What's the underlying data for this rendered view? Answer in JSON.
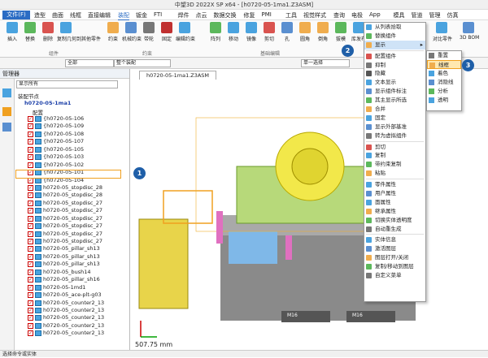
{
  "window": {
    "title": "中望3D 2022X SP x64 - [h0720-05-1ma1.Z3ASM]"
  },
  "menu": {
    "file": "文件(F)",
    "items": [
      "造型",
      "曲面",
      "线框",
      "直接编辑",
      "装配",
      "钣金",
      "FTI",
      "焊件",
      "点云",
      "数据交换",
      "修复",
      "PMI",
      "工具",
      "视觉样式",
      "查询",
      "电极",
      "App",
      "模具",
      "管道",
      "管理",
      "仿真"
    ]
  },
  "ribbon": {
    "buttons": [
      "插入",
      "替换",
      "删除",
      "复制几何到其他零件",
      "约束",
      "机械约束",
      "带轮",
      "固定",
      "编辑约束",
      "阵列",
      "移动",
      "镜像",
      "剪切",
      "孔",
      "圆角",
      "倒角",
      "拔模",
      "库发布",
      "检查",
      "对比零件",
      "3D BOM"
    ],
    "groups": [
      "组件",
      "约束",
      "基础编辑",
      "检查"
    ]
  },
  "toolbar2": {
    "filter": "全部",
    "scope": "整个装配",
    "select_mode": "单一选择"
  },
  "panel": {
    "title": "管理器",
    "combo": "显示所有",
    "section": "装配节点",
    "root": "h0720-05-1ma1",
    "config": "配置",
    "rows": [
      "{h0720-05-106",
      "{h0720-05-109",
      "{h0720-05-108",
      "{h0720-05-107",
      "{h0720-05-105",
      "{h0720-05-103",
      "{h0720-05-102",
      "{h0720-05-101",
      "{h0720-05-104",
      "h0720-05_stopdisc_28",
      "h0720-05_stopdisc_28",
      "h0720-05_stopdisc_27",
      "h0720-05_stopdisc_27",
      "h0720-05_stopdisc_27",
      "h0720-05_stopdisc_27",
      "h0720-05_stopdisc_27",
      "h0720-05_stopdisc_27",
      "h0720-05_pillar_sh13",
      "h0720-05_pillar_sh13",
      "h0720-05_pillar_sh13",
      "h0720-05_bush14",
      "h0720-05_pillar_sh16",
      "h0720-05-1md1",
      "h0720-05_ace-plt-g03",
      "h0720-05_counter2_13",
      "h0720-05_counter2_13",
      "h0720-05_counter2_13",
      "h0720-05_counter2_13",
      "h0720-05_counter2_13"
    ]
  },
  "viewport": {
    "tab": "h0720-05-1ma1.Z3ASM",
    "dimension": "507.75 mm",
    "labels": [
      "M16",
      "M16"
    ]
  },
  "context_menu": {
    "items": [
      "从列表拾取",
      "替换组件",
      "显示",
      "配置组件",
      "抑制",
      "隐藏",
      "文本显示",
      "显示组件标注",
      "其主显示所选",
      "合并",
      "固定",
      "显示外部基准",
      "转为虚拟组件",
      "剪切",
      "复制",
      "带约束复制",
      "粘贴",
      "零件属性",
      "用户属性",
      "面属性",
      "继承属性",
      "切换实体透明度",
      "自动重生成",
      "实体信息",
      "激活图层",
      "图层打开/关闭",
      "复制/移动到图层",
      "自定义菜单"
    ]
  },
  "submenu": {
    "items": [
      "重置",
      "线框",
      "着色",
      "消隐线",
      "分析",
      "透明"
    ]
  },
  "callouts": [
    "1",
    "2",
    "3"
  ],
  "status": {
    "text": "选择命令或实体"
  },
  "colors": {
    "accent": "#2b6cc4",
    "highlight": "#f0a020",
    "badge": "#1f5fa8"
  }
}
